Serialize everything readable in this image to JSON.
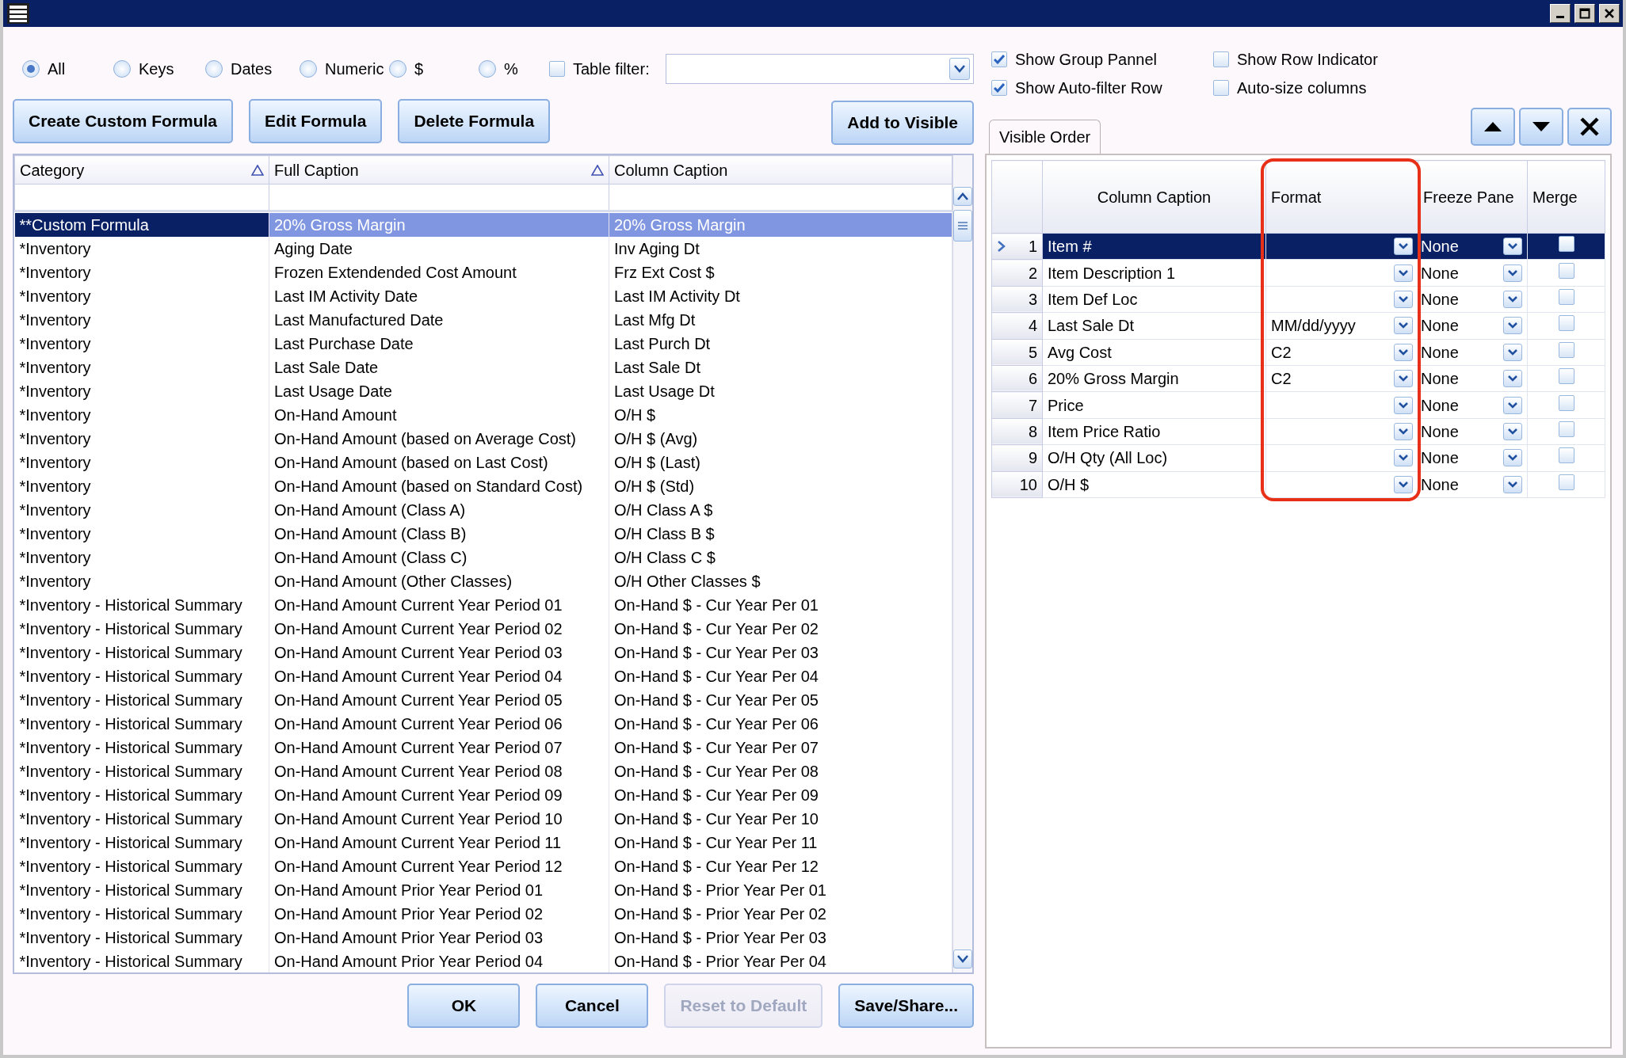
{
  "filters": {
    "radios": [
      {
        "label": "All",
        "selected": true
      },
      {
        "label": "Keys",
        "selected": false
      },
      {
        "label": "Dates",
        "selected": false
      },
      {
        "label": "Numeric",
        "selected": false
      },
      {
        "label": "$",
        "selected": false
      },
      {
        "label": "%",
        "selected": false
      }
    ],
    "table_filter": {
      "label": "Table filter:",
      "checked": false
    }
  },
  "options": [
    {
      "label": "Show Group Pannel",
      "checked": true
    },
    {
      "label": "Show Row Indicator",
      "checked": false
    },
    {
      "label": "Show Auto-filter Row",
      "checked": true
    },
    {
      "label": "Auto-size columns",
      "checked": false
    }
  ],
  "formula_buttons": [
    {
      "label": "Create Custom Formula"
    },
    {
      "label": "Edit Formula"
    },
    {
      "label": "Delete Formula"
    }
  ],
  "add_button": {
    "label": "Add to Visible"
  },
  "available": {
    "columns": [
      {
        "label": "Category",
        "sorted": true
      },
      {
        "label": "Full Caption",
        "sorted": true
      },
      {
        "label": "Column Caption",
        "sorted": false
      }
    ],
    "rows": [
      {
        "category": "**Custom Formula",
        "full_caption": "20% Gross Margin",
        "column_caption": "20% Gross Margin",
        "selected": true
      },
      {
        "category": "*Inventory",
        "full_caption": "Aging Date",
        "column_caption": "Inv Aging Dt",
        "selected": false
      },
      {
        "category": "*Inventory",
        "full_caption": "Frozen Extendended Cost Amount",
        "column_caption": "Frz Ext Cost $",
        "selected": false
      },
      {
        "category": "*Inventory",
        "full_caption": "Last IM Activity Date",
        "column_caption": "Last IM Activity Dt",
        "selected": false
      },
      {
        "category": "*Inventory",
        "full_caption": "Last Manufactured Date",
        "column_caption": "Last Mfg Dt",
        "selected": false
      },
      {
        "category": "*Inventory",
        "full_caption": "Last Purchase Date",
        "column_caption": "Last Purch Dt",
        "selected": false
      },
      {
        "category": "*Inventory",
        "full_caption": "Last Sale Date",
        "column_caption": "Last Sale Dt",
        "selected": false
      },
      {
        "category": "*Inventory",
        "full_caption": "Last Usage Date",
        "column_caption": "Last Usage Dt",
        "selected": false
      },
      {
        "category": "*Inventory",
        "full_caption": "On-Hand Amount",
        "column_caption": "O/H $",
        "selected": false
      },
      {
        "category": "*Inventory",
        "full_caption": "On-Hand Amount (based on Average Cost)",
        "column_caption": "O/H $ (Avg)",
        "selected": false
      },
      {
        "category": "*Inventory",
        "full_caption": "On-Hand Amount (based on Last Cost)",
        "column_caption": "O/H $ (Last)",
        "selected": false
      },
      {
        "category": "*Inventory",
        "full_caption": "On-Hand Amount (based on Standard Cost)",
        "column_caption": "O/H $ (Std)",
        "selected": false
      },
      {
        "category": "*Inventory",
        "full_caption": "On-Hand Amount (Class A)",
        "column_caption": "O/H Class A $",
        "selected": false
      },
      {
        "category": "*Inventory",
        "full_caption": "On-Hand Amount (Class B)",
        "column_caption": "O/H Class B $",
        "selected": false
      },
      {
        "category": "*Inventory",
        "full_caption": "On-Hand Amount (Class C)",
        "column_caption": "O/H Class C $",
        "selected": false
      },
      {
        "category": "*Inventory",
        "full_caption": "On-Hand Amount (Other Classes)",
        "column_caption": "O/H Other Classes $",
        "selected": false
      },
      {
        "category": "*Inventory - Historical Summary",
        "full_caption": "On-Hand Amount Current Year Period 01",
        "column_caption": "On-Hand $ - Cur Year Per 01",
        "selected": false
      },
      {
        "category": "*Inventory - Historical Summary",
        "full_caption": "On-Hand Amount Current Year Period 02",
        "column_caption": "On-Hand $ - Cur Year Per 02",
        "selected": false
      },
      {
        "category": "*Inventory - Historical Summary",
        "full_caption": "On-Hand Amount Current Year Period 03",
        "column_caption": "On-Hand $ - Cur Year Per 03",
        "selected": false
      },
      {
        "category": "*Inventory - Historical Summary",
        "full_caption": "On-Hand Amount Current Year Period 04",
        "column_caption": "On-Hand $ - Cur Year Per 04",
        "selected": false
      },
      {
        "category": "*Inventory - Historical Summary",
        "full_caption": "On-Hand Amount Current Year Period 05",
        "column_caption": "On-Hand $ - Cur Year Per 05",
        "selected": false
      },
      {
        "category": "*Inventory - Historical Summary",
        "full_caption": "On-Hand Amount Current Year Period 06",
        "column_caption": "On-Hand $ - Cur Year Per 06",
        "selected": false
      },
      {
        "category": "*Inventory - Historical Summary",
        "full_caption": "On-Hand Amount Current Year Period 07",
        "column_caption": "On-Hand $ - Cur Year Per 07",
        "selected": false
      },
      {
        "category": "*Inventory - Historical Summary",
        "full_caption": "On-Hand Amount Current Year Period 08",
        "column_caption": "On-Hand $ - Cur Year Per 08",
        "selected": false
      },
      {
        "category": "*Inventory - Historical Summary",
        "full_caption": "On-Hand Amount Current Year Period 09",
        "column_caption": "On-Hand $ - Cur Year Per 09",
        "selected": false
      },
      {
        "category": "*Inventory - Historical Summary",
        "full_caption": "On-Hand Amount Current Year Period 10",
        "column_caption": "On-Hand $ - Cur Year Per 10",
        "selected": false
      },
      {
        "category": "*Inventory - Historical Summary",
        "full_caption": "On-Hand Amount Current Year Period 11",
        "column_caption": "On-Hand $ - Cur Year Per 11",
        "selected": false
      },
      {
        "category": "*Inventory - Historical Summary",
        "full_caption": "On-Hand Amount Current Year Period 12",
        "column_caption": "On-Hand $ - Cur Year Per 12",
        "selected": false
      },
      {
        "category": "*Inventory - Historical Summary",
        "full_caption": "On-Hand Amount Prior Year Period 01",
        "column_caption": "On-Hand $ - Prior Year Per 01",
        "selected": false
      },
      {
        "category": "*Inventory - Historical Summary",
        "full_caption": "On-Hand Amount Prior Year Period 02",
        "column_caption": "On-Hand $ - Prior Year Per 02",
        "selected": false
      },
      {
        "category": "*Inventory - Historical Summary",
        "full_caption": "On-Hand Amount Prior Year Period 03",
        "column_caption": "On-Hand $ - Prior Year Per 03",
        "selected": false
      },
      {
        "category": "*Inventory - Historical Summary",
        "full_caption": "On-Hand Amount Prior Year Period 04",
        "column_caption": "On-Hand $ - Prior Year Per 04",
        "selected": false
      }
    ]
  },
  "tab": {
    "label": "Visible Order",
    "selected": true
  },
  "visible": {
    "columns": [
      {
        "label": "Column Caption",
        "highlighted": false
      },
      {
        "label": "Format",
        "highlighted": true
      },
      {
        "label": "Freeze Pane",
        "highlighted": false
      },
      {
        "label": "Merge",
        "highlighted": false
      }
    ],
    "rows": [
      {
        "number": "1",
        "caption": "Item #",
        "format": "",
        "freeze": "None",
        "merge": false,
        "selected": true
      },
      {
        "number": "2",
        "caption": "Item Description 1",
        "format": "",
        "freeze": "None",
        "merge": false,
        "selected": false
      },
      {
        "number": "3",
        "caption": "Item Def Loc",
        "format": "",
        "freeze": "None",
        "merge": false,
        "selected": false
      },
      {
        "number": "4",
        "caption": "Last Sale Dt",
        "format": "MM/dd/yyyy",
        "freeze": "None",
        "merge": false,
        "selected": false
      },
      {
        "number": "5",
        "caption": "Avg Cost",
        "format": "C2",
        "freeze": "None",
        "merge": false,
        "selected": false
      },
      {
        "number": "6",
        "caption": "20% Gross Margin",
        "format": "C2",
        "freeze": "None",
        "merge": false,
        "selected": false
      },
      {
        "number": "7",
        "caption": "Price",
        "format": "",
        "freeze": "None",
        "merge": false,
        "selected": false
      },
      {
        "number": "8",
        "caption": "Item Price Ratio",
        "format": "",
        "freeze": "None",
        "merge": false,
        "selected": false
      },
      {
        "number": "9",
        "caption": "O/H Qty (All Loc)",
        "format": "",
        "freeze": "None",
        "merge": false,
        "selected": false
      },
      {
        "number": "10",
        "caption": "O/H $",
        "format": "",
        "freeze": "None",
        "merge": false,
        "selected": false
      }
    ]
  },
  "footer_buttons": [
    {
      "label": "OK",
      "disabled": false
    },
    {
      "label": "Cancel",
      "disabled": false
    },
    {
      "label": "Reset to Default",
      "disabled": true
    },
    {
      "label": "Save/Share...",
      "disabled": false
    }
  ]
}
